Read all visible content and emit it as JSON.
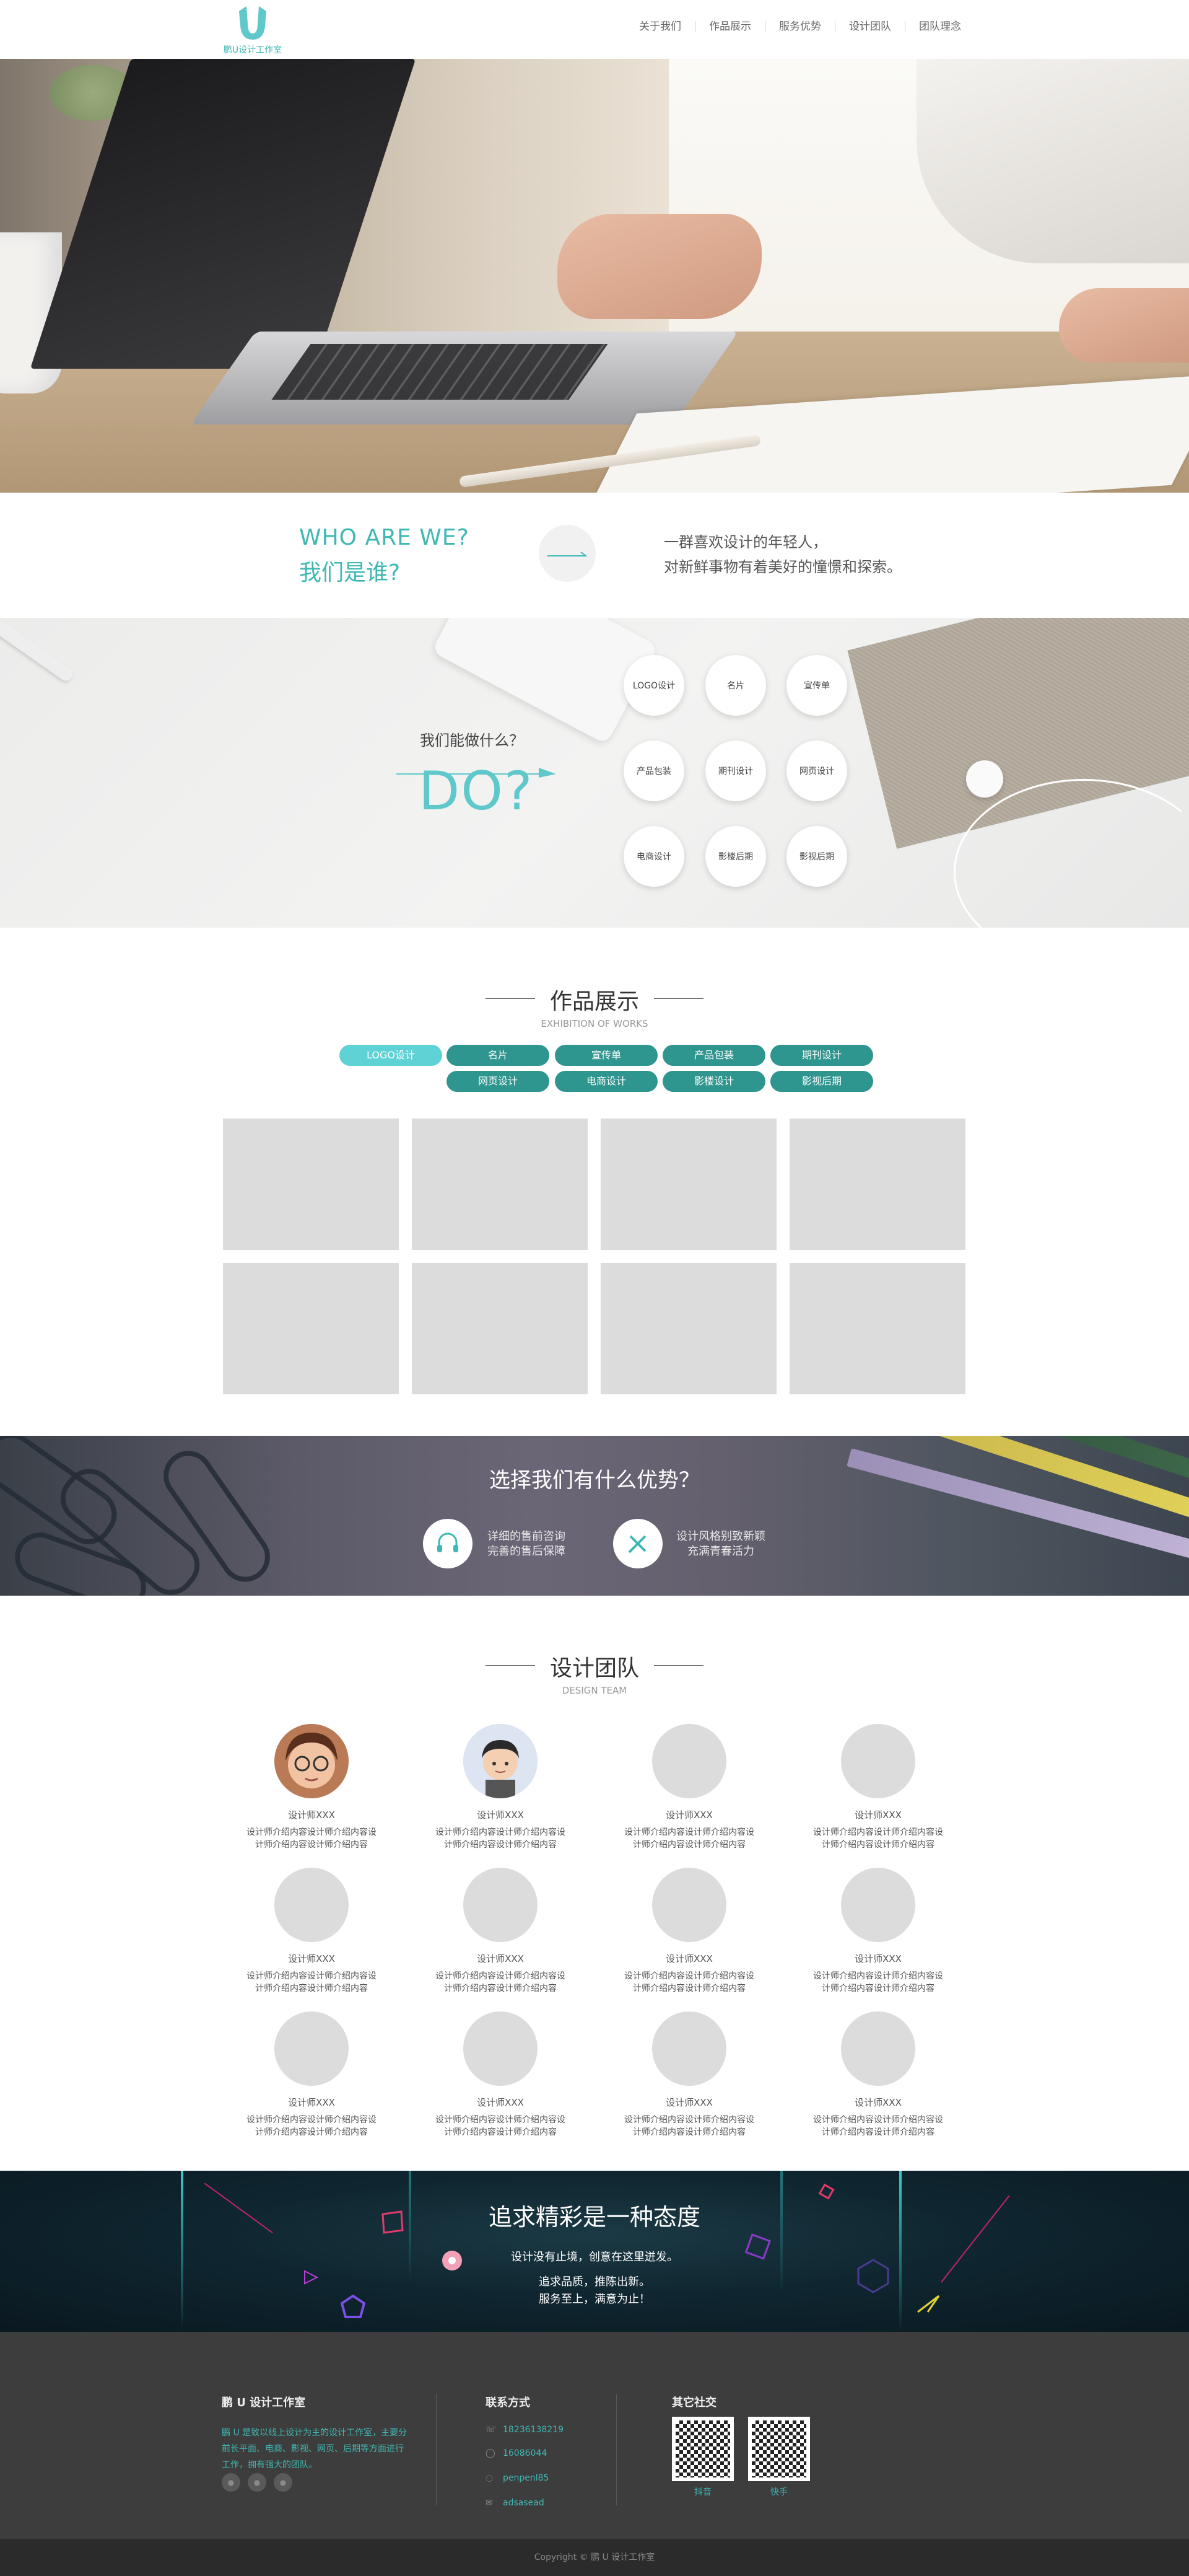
{
  "header": {
    "logo_text": "鹏U设计工作室",
    "nav": [
      "关于我们",
      "作品展示",
      "服务优势",
      "设计团队",
      "团队理念"
    ]
  },
  "who": {
    "title_en": "WHO ARE WE?",
    "title_cn": "我们是谁?",
    "desc_line1": "一群喜欢设计的年轻人，",
    "desc_line2": "对新鲜事物有着美好的憧憬和探索。"
  },
  "do": {
    "question": "我们能做什么？",
    "big": "DO?",
    "services": [
      "LOGO设计",
      "名片",
      "宣传单",
      "产品包装",
      "期刊设计",
      "网页设计",
      "电商设计",
      "影楼后期",
      "影视后期"
    ]
  },
  "works": {
    "title": "作品展示",
    "subtitle": "EXHIBITION OF WORKS",
    "tabs_row1": [
      "LOGO设计",
      "名片",
      "宣传单",
      "产品包装",
      "期刊设计"
    ],
    "tabs_row2": [
      "网页设计",
      "电商设计",
      "影楼设计",
      "影视后期"
    ],
    "active_tab": "LOGO设计"
  },
  "advantages": {
    "title": "选择我们有什么优势？",
    "items": [
      {
        "line1": "详细的售前咨询",
        "line2": "完善的售后保障",
        "icon": "headset-icon"
      },
      {
        "line1": "设计风格别致新颖",
        "line2": "充满青春活力",
        "icon": "pencil-ruler-icon"
      }
    ]
  },
  "team": {
    "title": "设计团队",
    "subtitle": "DESIGN TEAM",
    "members": [
      {
        "name": "设计师XXX",
        "bio1": "设计师介绍内容设计师介绍内容设",
        "bio2": "计师介绍内容设计师介绍内容",
        "avatar": "girl"
      },
      {
        "name": "设计师XXX",
        "bio1": "设计师介绍内容设计师介绍内容设",
        "bio2": "计师介绍内容设计师介绍内容",
        "avatar": "boy"
      },
      {
        "name": "设计师XXX",
        "bio1": "设计师介绍内容设计师介绍内容设",
        "bio2": "计师介绍内容设计师介绍内容",
        "avatar": "none"
      },
      {
        "name": "设计师XXX",
        "bio1": "设计师介绍内容设计师介绍内容设",
        "bio2": "计师介绍内容设计师介绍内容",
        "avatar": "none"
      },
      {
        "name": "设计师XXX",
        "bio1": "设计师介绍内容设计师介绍内容设",
        "bio2": "计师介绍内容设计师介绍内容",
        "avatar": "none"
      },
      {
        "name": "设计师XXX",
        "bio1": "设计师介绍内容设计师介绍内容设",
        "bio2": "计师介绍内容设计师介绍内容",
        "avatar": "none"
      },
      {
        "name": "设计师XXX",
        "bio1": "设计师介绍内容设计师介绍内容设",
        "bio2": "计师介绍内容设计师介绍内容",
        "avatar": "none"
      },
      {
        "name": "设计师XXX",
        "bio1": "设计师介绍内容设计师介绍内容设",
        "bio2": "计师介绍内容设计师介绍内容",
        "avatar": "none"
      },
      {
        "name": "设计师XXX",
        "bio1": "设计师介绍内容设计师介绍内容设",
        "bio2": "计师介绍内容设计师介绍内容",
        "avatar": "none"
      },
      {
        "name": "设计师XXX",
        "bio1": "设计师介绍内容设计师介绍内容设",
        "bio2": "计师介绍内容设计师介绍内容",
        "avatar": "none"
      },
      {
        "name": "设计师XXX",
        "bio1": "设计师介绍内容设计师介绍内容设",
        "bio2": "计师介绍内容设计师介绍内容",
        "avatar": "none"
      },
      {
        "name": "设计师XXX",
        "bio1": "设计师介绍内容设计师介绍内容设",
        "bio2": "计师介绍内容设计师介绍内容",
        "avatar": "none"
      }
    ]
  },
  "banner": {
    "title": "追求精彩是一种态度",
    "line1": "设计没有止境，创意在这里迸发。",
    "line2": "追求品质，推陈出新。",
    "line3": "服务至上，满意为止！"
  },
  "footer": {
    "about_title": "鹏 U 设计工作室",
    "about_text": "鹏 U 是致以线上设计为主的设计工作室，主要分前长平面、电商、影视、网页、后期等方面进行工作，拥有强大的团队。",
    "contact_title": "联系方式",
    "contacts": [
      {
        "icon": "phone-icon",
        "text": "18236138219"
      },
      {
        "icon": "qq-icon",
        "text": "16086044"
      },
      {
        "icon": "wechat-icon",
        "text": "penpenl85"
      },
      {
        "icon": "mail-icon",
        "text": "adsasead"
      }
    ],
    "social_title": "其它社交",
    "qr1_label": "抖音",
    "qr2_label": "快手",
    "copyright": "Copyright © 鹏 U 设计工作室"
  },
  "colors": {
    "accent": "#3fb8b4",
    "tab": "#2f958f",
    "tab_active": "#5fd2d5"
  }
}
